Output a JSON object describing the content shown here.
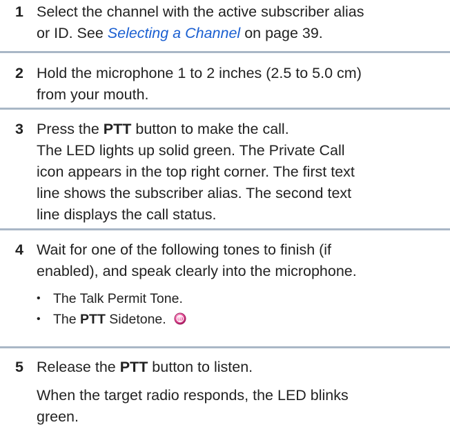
{
  "steps": [
    {
      "number": "1",
      "lines": [
        [
          "Select the channel with the active subscriber alias"
        ],
        [
          "or ID. See ",
          {
            "link": "Selecting a Channel"
          },
          " on page 39."
        ]
      ]
    },
    {
      "number": "2",
      "line1": "Hold the microphone 1 to 2 inches (2.5 to 5.0 cm)",
      "line2": "from your mouth."
    },
    {
      "number": "3",
      "line1_pre": "Press the ",
      "line1_bold": "PTT",
      "line1_post": " button to make the call.",
      "line2": "The LED lights up solid green. The Private Call",
      "line3": "icon appears in the top right corner. The first text",
      "line4": "line shows the subscriber alias. The second text",
      "line5": "line displays the call status."
    },
    {
      "number": "4",
      "line1": "Wait for one of the following tones to finish (if",
      "line2": "enabled), and speak clearly into the microphone.",
      "bullets": {
        "b1": "The Talk Permit Tone.",
        "b2_pre": "The ",
        "b2_bold": "PTT",
        "b2_post": " Sidetone."
      },
      "feature_icon": "radio-feature-icon"
    },
    {
      "number": "5",
      "line1_pre": "Release the ",
      "line1_bold": "PTT",
      "line1_post": " button to listen.",
      "line2": "When the target radio responds, the LED blinks",
      "line3": "green."
    }
  ],
  "step1_line1": "Select the channel with the active subscriber alias",
  "step1_line2_pre": "or ID. See ",
  "step1_link": "Selecting a Channel",
  "step1_line2_post": " on page 39.",
  "colors": {
    "text": "#222222",
    "link": "#1a5fd1",
    "divider": "#a9b7c6",
    "icon": "#d63384"
  }
}
